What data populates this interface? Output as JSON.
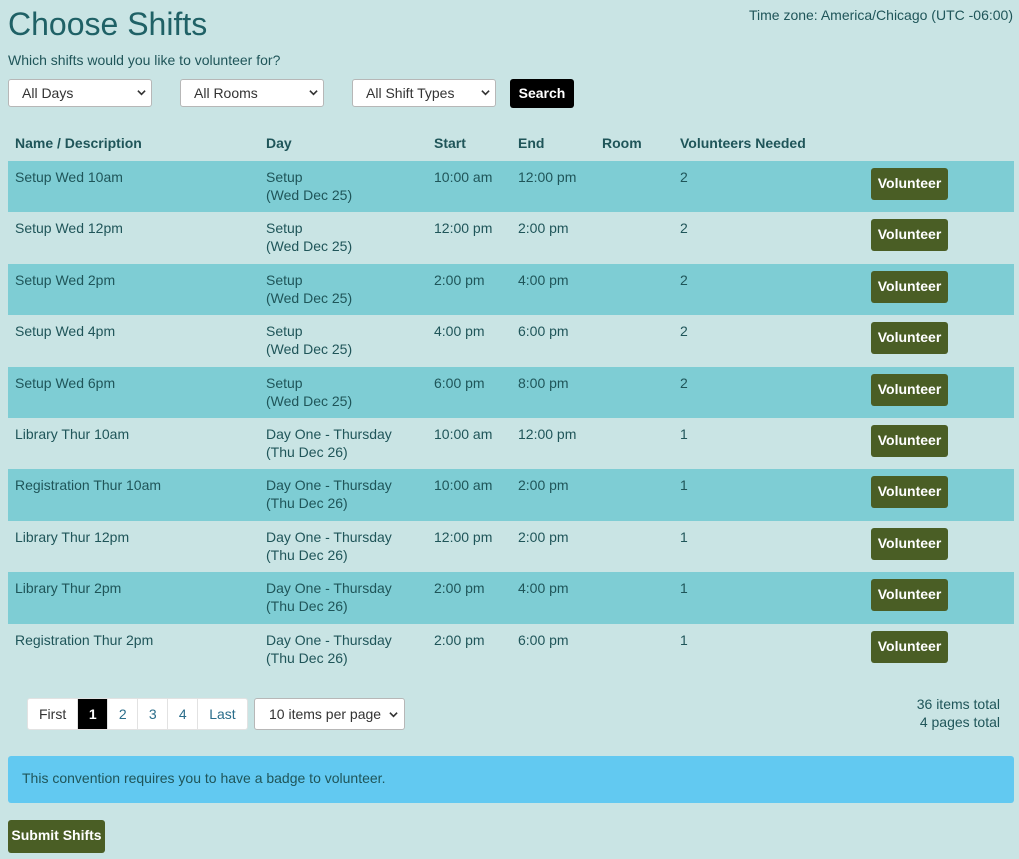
{
  "header": {
    "title": "Choose Shifts",
    "timezone": "Time zone: America/Chicago (UTC -06:00)",
    "subtitle": "Which shifts would you like to volunteer for?"
  },
  "filters": {
    "days": "All Days",
    "rooms": "All Rooms",
    "shift_types": "All Shift Types",
    "search_label": "Search"
  },
  "table": {
    "columns": [
      "Name / Description",
      "Day",
      "Start",
      "End",
      "Room",
      "Volunteers Needed"
    ],
    "volunteer_label": "Volunteer",
    "rows": [
      {
        "name": "Setup Wed 10am",
        "day": "Setup",
        "date": "(Wed Dec 25)",
        "start": "10:00 am",
        "end": "12:00 pm",
        "room": "",
        "needed": "2"
      },
      {
        "name": "Setup Wed 12pm",
        "day": "Setup",
        "date": "(Wed Dec 25)",
        "start": "12:00 pm",
        "end": "2:00 pm",
        "room": "",
        "needed": "2"
      },
      {
        "name": "Setup Wed 2pm",
        "day": "Setup",
        "date": "(Wed Dec 25)",
        "start": "2:00 pm",
        "end": "4:00 pm",
        "room": "",
        "needed": "2"
      },
      {
        "name": "Setup Wed 4pm",
        "day": "Setup",
        "date": "(Wed Dec 25)",
        "start": "4:00 pm",
        "end": "6:00 pm",
        "room": "",
        "needed": "2"
      },
      {
        "name": "Setup Wed 6pm",
        "day": "Setup",
        "date": "(Wed Dec 25)",
        "start": "6:00 pm",
        "end": "8:00 pm",
        "room": "",
        "needed": "2"
      },
      {
        "name": "Library Thur 10am",
        "day": "Day One - Thursday",
        "date": "(Thu Dec 26)",
        "start": "10:00 am",
        "end": "12:00 pm",
        "room": "",
        "needed": "1"
      },
      {
        "name": "Registration Thur 10am",
        "day": "Day One - Thursday",
        "date": "(Thu Dec 26)",
        "start": "10:00 am",
        "end": "2:00 pm",
        "room": "",
        "needed": "1"
      },
      {
        "name": "Library Thur 12pm",
        "day": "Day One - Thursday",
        "date": "(Thu Dec 26)",
        "start": "12:00 pm",
        "end": "2:00 pm",
        "room": "",
        "needed": "1"
      },
      {
        "name": "Library Thur 2pm",
        "day": "Day One - Thursday",
        "date": "(Thu Dec 26)",
        "start": "2:00 pm",
        "end": "4:00 pm",
        "room": "",
        "needed": "1"
      },
      {
        "name": "Registration Thur 2pm",
        "day": "Day One - Thursday",
        "date": "(Thu Dec 26)",
        "start": "2:00 pm",
        "end": "6:00 pm",
        "room": "",
        "needed": "1"
      }
    ]
  },
  "pagination": {
    "first": "First",
    "pages": [
      "1",
      "2",
      "3",
      "4"
    ],
    "last": "Last",
    "per_page": "10 items per page",
    "items_total": "36 items total",
    "pages_total": "4 pages total"
  },
  "notice": "This convention requires you to have a badge to volunteer.",
  "submit_label": "Submit Shifts",
  "colors": {
    "background": "#c9e4e4",
    "alt_row": "#7ecdd4",
    "button_green": "#4a5e25",
    "notice_blue": "#62c9f1",
    "active_page": "#000000"
  },
  "icons": {
    "select_chevron": "chevron-down-icon"
  }
}
